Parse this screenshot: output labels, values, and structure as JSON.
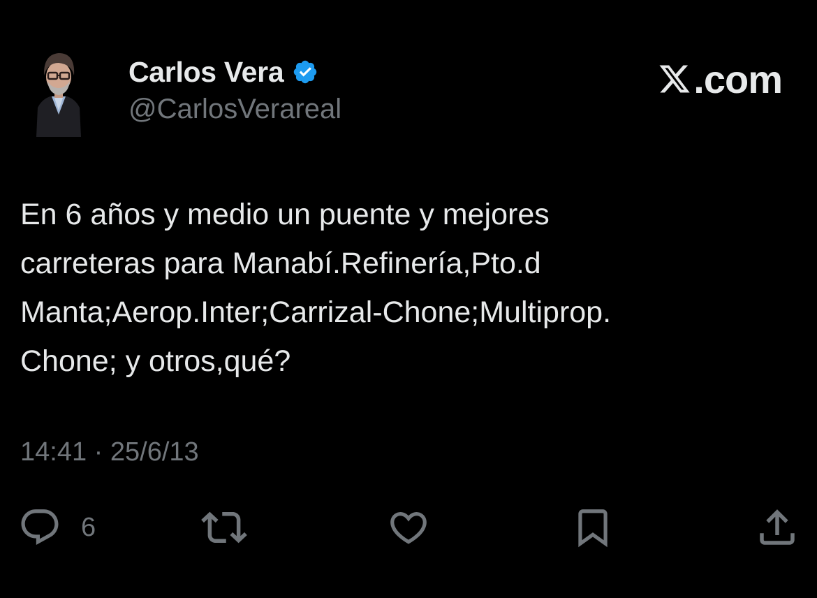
{
  "tweet": {
    "author": {
      "display_name": "Carlos Vera",
      "handle": "@CarlosVerareal",
      "verified": true
    },
    "brand": {
      "text": ".com",
      "icon": "x-logo-icon"
    },
    "text": "En 6 años y medio un puente y mejores\ncarreteras para Manabí.Refinería,Pto.d\nManta;Aerop.Inter;Carrizal-Chone;Multiprop.\nChone; y otros,qué?",
    "time": "14:41",
    "separator": "·",
    "date": "25/6/13",
    "actions": {
      "reply": {
        "icon": "reply-icon",
        "count": "6"
      },
      "repost": {
        "icon": "repost-icon"
      },
      "like": {
        "icon": "heart-icon"
      },
      "bookmark": {
        "icon": "bookmark-icon"
      },
      "share": {
        "icon": "share-icon"
      }
    }
  },
  "colors": {
    "background": "#000000",
    "primary_text": "#e7e9ea",
    "secondary_text": "#71767b",
    "verified_badge": "#1d9bf0"
  }
}
